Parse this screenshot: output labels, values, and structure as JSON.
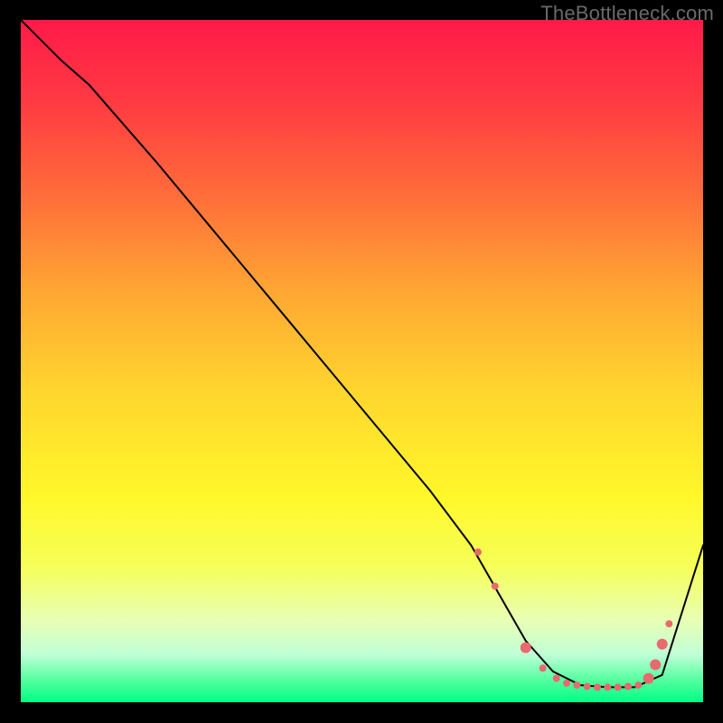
{
  "watermark": "TheBottleneck.com",
  "chart_data": {
    "type": "line",
    "title": "",
    "xlabel": "",
    "ylabel": "",
    "xlim": [
      0,
      100
    ],
    "ylim": [
      0,
      100
    ],
    "grid": false,
    "legend": false,
    "background_gradient": [
      "#ff1a49",
      "#ffd72e",
      "#00ff84"
    ],
    "series": [
      {
        "name": "curve",
        "x": [
          0,
          6,
          10,
          20,
          30,
          40,
          50,
          60,
          66,
          70,
          74,
          78,
          82,
          86,
          90,
          94,
          100
        ],
        "y": [
          100,
          94,
          90.5,
          79,
          67,
          55,
          43,
          31,
          23,
          16,
          9,
          4.5,
          2.5,
          2.2,
          2.2,
          4,
          23
        ]
      }
    ],
    "markers": {
      "color": "#e76a6d",
      "radius_small": 4,
      "radius_large": 6,
      "points": [
        {
          "x": 67,
          "y": 22,
          "r": "small"
        },
        {
          "x": 69.5,
          "y": 17,
          "r": "small"
        },
        {
          "x": 74,
          "y": 8,
          "r": "large"
        },
        {
          "x": 76.5,
          "y": 5,
          "r": "small"
        },
        {
          "x": 78.5,
          "y": 3.5,
          "r": "small"
        },
        {
          "x": 80,
          "y": 2.8,
          "r": "small"
        },
        {
          "x": 81.5,
          "y": 2.5,
          "r": "small"
        },
        {
          "x": 83,
          "y": 2.3,
          "r": "small"
        },
        {
          "x": 84.5,
          "y": 2.2,
          "r": "small"
        },
        {
          "x": 86,
          "y": 2.2,
          "r": "small"
        },
        {
          "x": 87.5,
          "y": 2.2,
          "r": "small"
        },
        {
          "x": 89,
          "y": 2.3,
          "r": "small"
        },
        {
          "x": 90.5,
          "y": 2.5,
          "r": "small"
        },
        {
          "x": 92,
          "y": 3.5,
          "r": "large"
        },
        {
          "x": 93,
          "y": 5.5,
          "r": "large"
        },
        {
          "x": 94,
          "y": 8.5,
          "r": "large"
        },
        {
          "x": 95,
          "y": 11.5,
          "r": "small"
        }
      ]
    }
  }
}
